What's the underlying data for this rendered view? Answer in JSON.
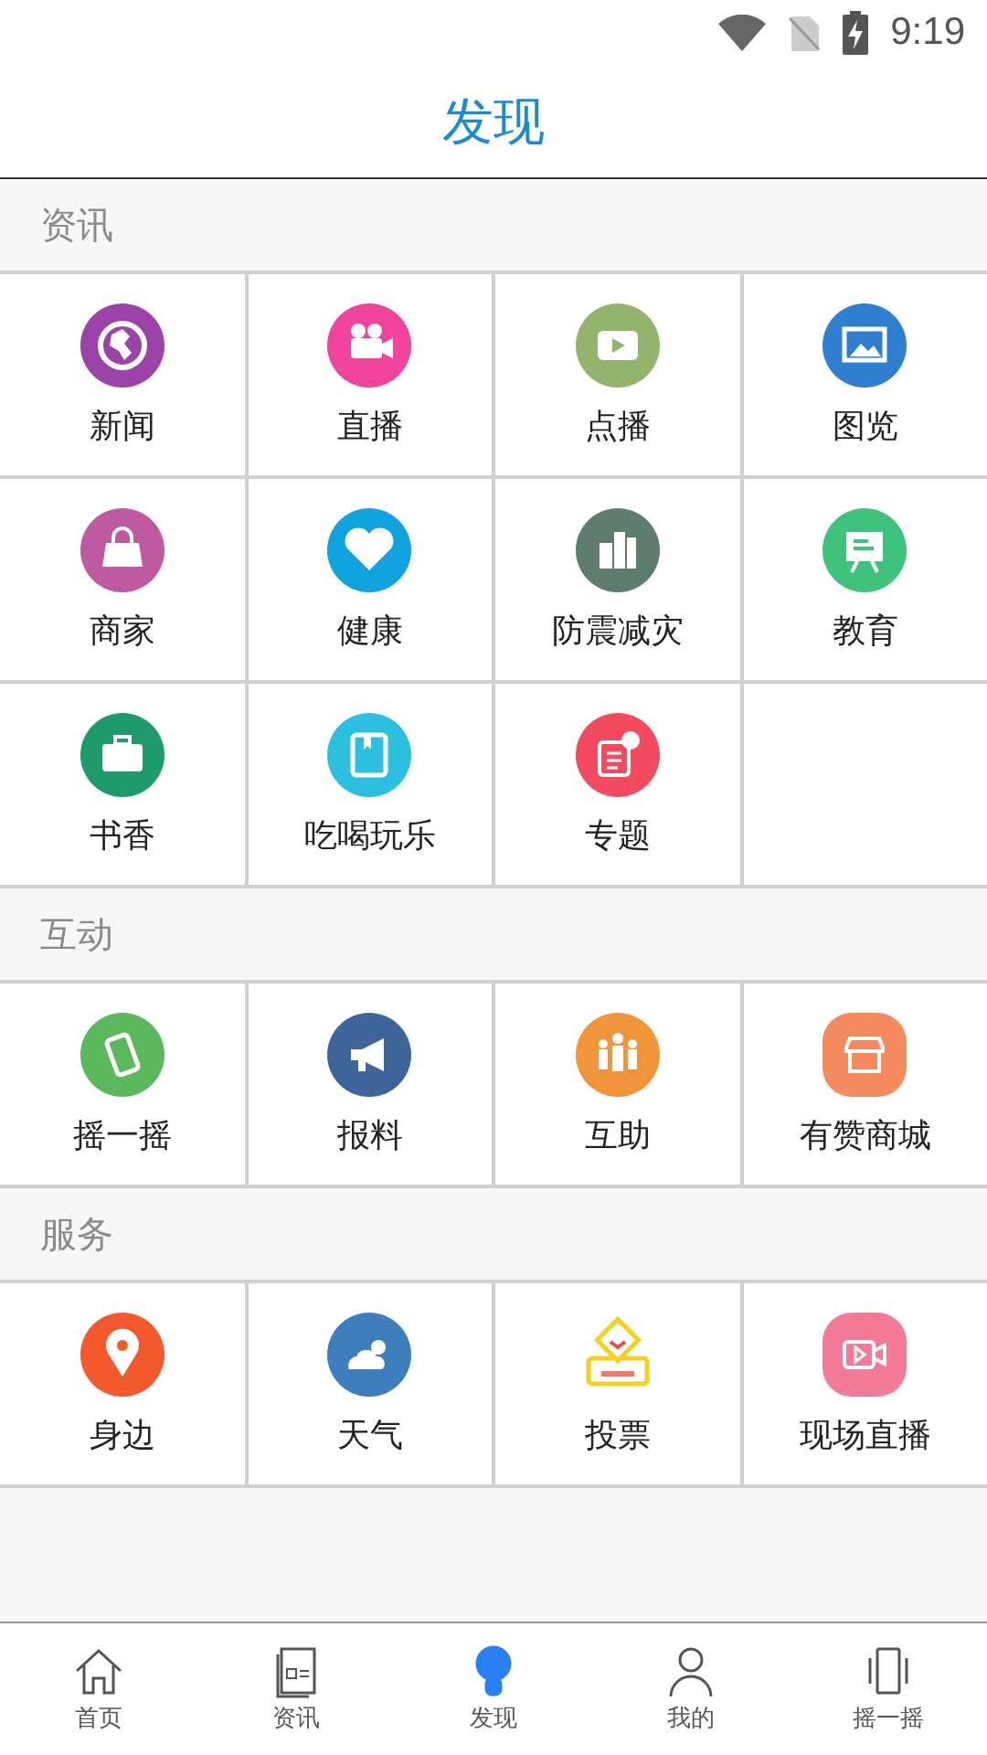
{
  "status_bar": {
    "time": "9:19"
  },
  "header": {
    "title": "发现"
  },
  "sections": [
    {
      "title": "资讯",
      "items": [
        {
          "label": "新闻"
        },
        {
          "label": "直播"
        },
        {
          "label": "点播"
        },
        {
          "label": "图览"
        },
        {
          "label": "商家"
        },
        {
          "label": "健康"
        },
        {
          "label": "防震减灾"
        },
        {
          "label": "教育"
        },
        {
          "label": "书香"
        },
        {
          "label": "吃喝玩乐"
        },
        {
          "label": "专题"
        }
      ]
    },
    {
      "title": "互动",
      "items": [
        {
          "label": "摇一摇"
        },
        {
          "label": "报料"
        },
        {
          "label": "互助"
        },
        {
          "label": "有赞商城"
        }
      ]
    },
    {
      "title": "服务",
      "items": [
        {
          "label": "身边"
        },
        {
          "label": "天气"
        },
        {
          "label": "投票"
        },
        {
          "label": "现场直播"
        }
      ]
    }
  ],
  "bottom_nav": [
    {
      "label": "首页",
      "selected": false
    },
    {
      "label": "资讯",
      "selected": false
    },
    {
      "label": "发现",
      "selected": true
    },
    {
      "label": "我的",
      "selected": false
    },
    {
      "label": "摇一摇",
      "selected": false
    }
  ]
}
